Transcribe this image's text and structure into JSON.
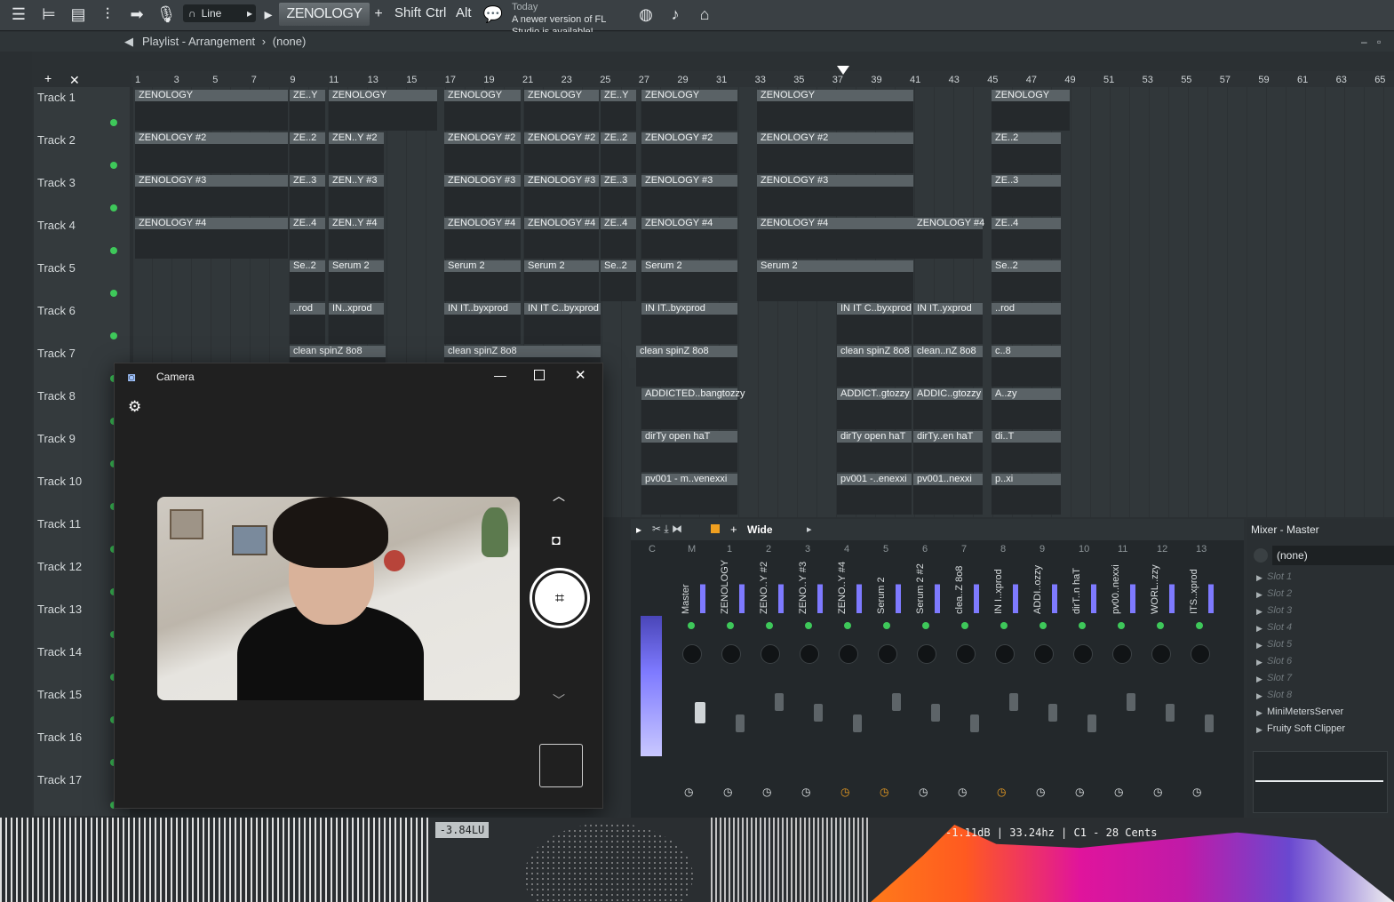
{
  "toolbar": {
    "snap_label": "Line",
    "pattern_name": "ZENOLOGY",
    "keys": [
      "Shift",
      "Ctrl",
      "Alt"
    ],
    "news_day": "Today",
    "news_text": "A newer version of FL Studio is available!"
  },
  "playlist": {
    "title": "Playlist - Arrangement",
    "breadcrumb": "(none)",
    "ruler": [
      "1",
      "3",
      "5",
      "7",
      "9",
      "11",
      "13",
      "15",
      "17",
      "19",
      "21",
      "23",
      "25",
      "27",
      "29",
      "31",
      "33",
      "35",
      "37",
      "39",
      "41",
      "43",
      "45",
      "47",
      "49",
      "51",
      "53",
      "55",
      "57",
      "59",
      "61",
      "63",
      "65"
    ],
    "tracks": [
      "Track 1",
      "Track 2",
      "Track 3",
      "Track 4",
      "Track 5",
      "Track 6",
      "Track 7",
      "Track 8",
      "Track 9",
      "Track 10",
      "Track 11",
      "Track 12",
      "Track 13",
      "Track 14",
      "Track 15",
      "Track 16",
      "Track 17"
    ],
    "clips": {
      "t1": [
        "ZENOLOGY",
        "ZE..Y",
        "ZENOLOGY",
        "ZENOLOGY",
        "ZENOLOGY",
        "ZE..Y",
        "ZENOLOGY",
        "ZENOLOGY",
        "ZENOLOGY"
      ],
      "t2": [
        "ZENOLOGY #2",
        "ZE..2",
        "ZEN..Y #2",
        "ZENOLOGY #2",
        "ZENOLOGY #2",
        "ZE..2",
        "ZENOLOGY #2",
        "ZENOLOGY #2",
        "ZE..2"
      ],
      "t3": [
        "ZENOLOGY #3",
        "ZE..3",
        "ZEN..Y #3",
        "ZENOLOGY #3",
        "ZENOLOGY #3",
        "ZE..3",
        "ZENOLOGY #3",
        "ZENOLOGY #3",
        "ZE..3"
      ],
      "t4": [
        "ZENOLOGY #4",
        "ZE..4",
        "ZEN..Y #4",
        "ZENOLOGY #4",
        "ZENOLOGY #4",
        "ZE..4",
        "ZENOLOGY #4",
        "ZENOLOGY #4",
        "ZENOLOGY #4",
        "ZE..4"
      ],
      "t5": [
        "Se..2",
        "Serum 2",
        "Serum 2",
        "Serum 2",
        "Se..2",
        "Serum 2",
        "Serum 2",
        "Se..2"
      ],
      "t6": [
        "..rod",
        "IN..xprod",
        "IN IT..byxprod",
        "IN IT C..byxprod",
        "IN IT..byxprod",
        "IN IT C..byxprod",
        "IN IT..yxprod",
        "..rod"
      ],
      "t7": [
        "clean spinZ 8o8",
        "clean spinZ 8o8",
        "clean spinZ 8o8",
        "clean spinZ 8o8",
        "clean..nZ 8o8",
        "c..8"
      ],
      "t8": [
        "ADDICTED..bangtozzy",
        "ADDICT..gtozzy",
        "ADDIC..gtozzy",
        "A..zy"
      ],
      "t9": [
        "dirTy open haT",
        "dirTy open haT",
        "dirTy..en haT",
        "di..T"
      ],
      "t10": [
        "pv001 - m..venexxi",
        "pv001 -..enexxi",
        "pv001..nexxi",
        "p..xi"
      ]
    }
  },
  "camera": {
    "title": "Camera"
  },
  "mixer": {
    "mode": "Wide",
    "strips": [
      {
        "num": "C",
        "name": ""
      },
      {
        "num": "M",
        "name": "Master"
      },
      {
        "num": "1",
        "name": "ZENOLOGY"
      },
      {
        "num": "2",
        "name": "ZENO..Y #2"
      },
      {
        "num": "3",
        "name": "ZENO..Y #3"
      },
      {
        "num": "4",
        "name": "ZENO..Y #4"
      },
      {
        "num": "5",
        "name": "Serum 2"
      },
      {
        "num": "6",
        "name": "Serum 2 #2"
      },
      {
        "num": "7",
        "name": "clea..Z 8o8"
      },
      {
        "num": "8",
        "name": "IN I..xprod"
      },
      {
        "num": "9",
        "name": "ADDI..ozzy"
      },
      {
        "num": "10",
        "name": "dirT..n haT"
      },
      {
        "num": "11",
        "name": "pv00..nexxi"
      },
      {
        "num": "12",
        "name": "WORL..zzy"
      },
      {
        "num": "13",
        "name": "ITS..xprod"
      }
    ],
    "meter_scale": [
      "3",
      "0",
      "3"
    ]
  },
  "mixer_master": {
    "title": "Mixer - Master",
    "input": "(none)",
    "slots": [
      "Slot 1",
      "Slot 2",
      "Slot 3",
      "Slot 4",
      "Slot 5",
      "Slot 6",
      "Slot 7",
      "Slot 8"
    ],
    "plugins": [
      "MiniMetersServer",
      "Fruity Soft Clipper"
    ]
  },
  "visualizer": {
    "loudness": "-3.84LU",
    "readout": "-1.11dB | 33.24hz | C1 - 28 Cents"
  },
  "colors": {
    "accent_green": "#3ec85a",
    "meter_blue": "#6b63ff",
    "spectrum_orange": "#ff7a1a",
    "spectrum_magenta": "#e0149c"
  }
}
